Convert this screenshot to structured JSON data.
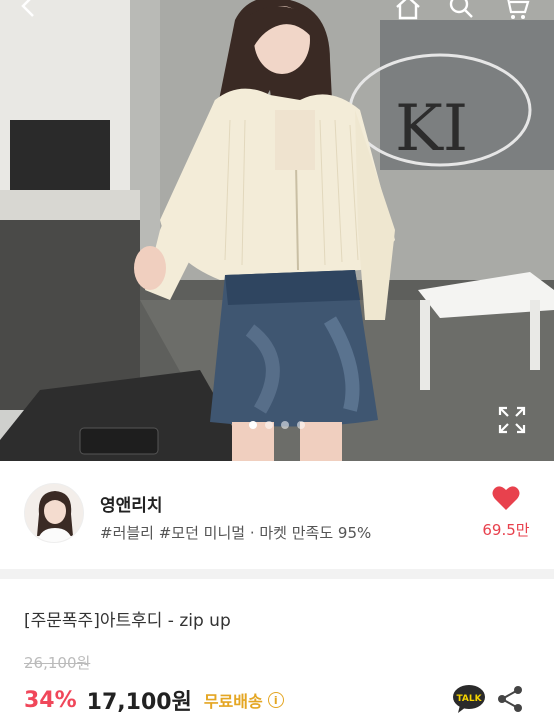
{
  "header": {
    "icons": [
      "back-arrow-icon",
      "home-icon",
      "search-icon",
      "cart-icon"
    ]
  },
  "gallery": {
    "total_slides": 4,
    "active_slide": 1
  },
  "seller": {
    "name": "영앤리치",
    "tags": "#러블리 #모던 미니멀 · 마켓 만족도 95%",
    "like_count": "69.5만",
    "heart_color": "#e8414d"
  },
  "product": {
    "name": "[주문폭주]아트후디 - zip up",
    "original_price": "26,100원",
    "discount": "34%",
    "price": "17,100원",
    "shipping": "무료배송",
    "talk_label": "TALK"
  },
  "colors": {
    "discount": "#f0475a",
    "shipping": "#e4a623",
    "like": "#e8414d"
  }
}
